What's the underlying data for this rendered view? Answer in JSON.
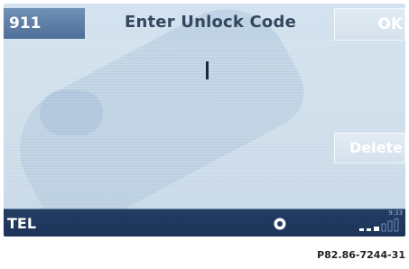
{
  "header": {
    "top_left_label": "911",
    "title": "Enter Unlock Code",
    "ok_label": "OK"
  },
  "input": {
    "value": ""
  },
  "actions": {
    "delete_label": "Delete"
  },
  "status_bar": {
    "mode_label": "TEL",
    "time": "9:33",
    "status_icon": "ring-icon",
    "signal_icon": "signal-strength-icon"
  },
  "reference_code": "P82.86-7244-31",
  "colors": {
    "screen_bg": "#d3e2ee",
    "status_bar_bg": "#223d63",
    "label_bg": "#4f6f98",
    "title_text": "#34475f"
  }
}
